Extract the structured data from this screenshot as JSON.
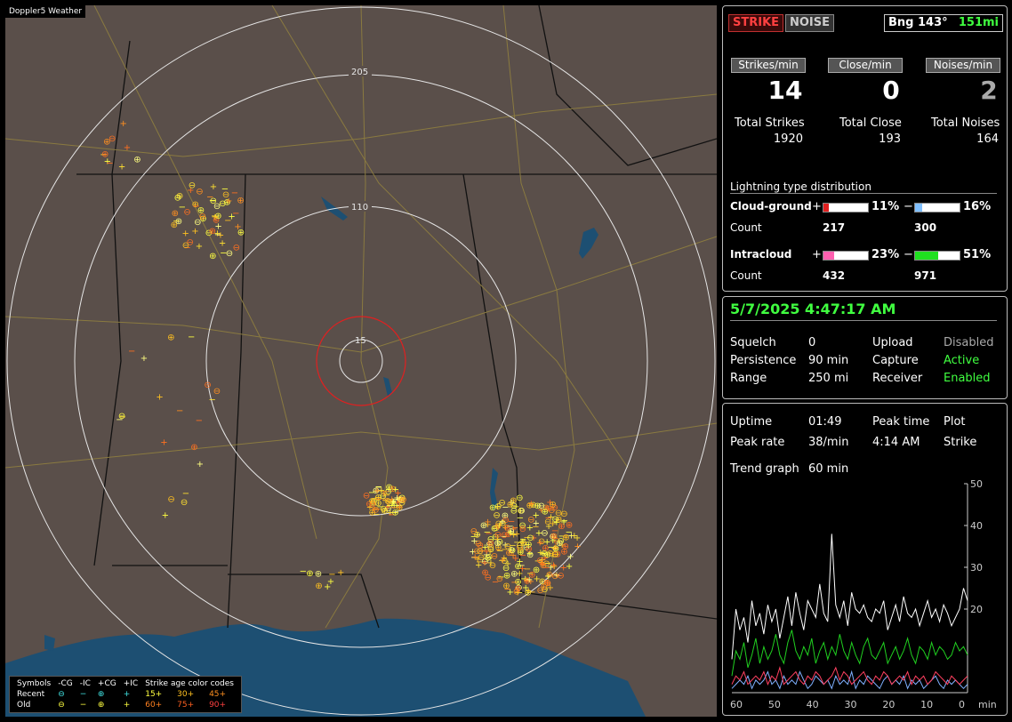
{
  "map": {
    "title": "Doppler5 Weather",
    "ring_labels": [
      "205",
      "110",
      "15"
    ],
    "colors": {
      "land": "#5a4f4a",
      "water": "#1d4f72",
      "ring": "#e6e6e6",
      "close_ring": "#e02020",
      "road": "#8a7a40"
    },
    "legend": {
      "symbols_label": "Symbols",
      "cols": [
        "-CG",
        "-IC",
        "+CG",
        "+IC"
      ],
      "recent_label": "Recent",
      "old_label": "Old",
      "recent_symbols": [
        "⊖",
        "−",
        "⊕",
        "+"
      ],
      "old_symbols": [
        "⊖",
        "−",
        "⊕",
        "+"
      ],
      "age_label": "Strike age color codes",
      "age_row1": [
        "15+",
        "30+",
        "45+"
      ],
      "age_row2": [
        "60+",
        "75+",
        "90+"
      ]
    }
  },
  "status": {
    "strike_btn": "STRIKE",
    "noise_btn": "NOISE",
    "bearing": "Bng 143°",
    "distance": "151mi",
    "headers": [
      "Strikes/min",
      "Close/min",
      "Noises/min"
    ],
    "rates": [
      "14",
      "0",
      "2"
    ],
    "totals_labels": [
      "Total Strikes",
      "Total Close",
      "Total Noises"
    ],
    "totals": [
      "1920",
      "193",
      "164"
    ],
    "dist_title": "Lightning type distribution",
    "cg_label": "Cloud-ground",
    "ic_label": "Intracloud",
    "count_label": "Count",
    "plus": "+",
    "minus": "−",
    "cg_pos_pct": "11%",
    "cg_neg_pct": "16%",
    "ic_pos_pct": "23%",
    "ic_neg_pct": "51%",
    "cg_pos_count": "217",
    "cg_neg_count": "300",
    "ic_pos_count": "432",
    "ic_neg_count": "971",
    "cg_pos_frac": 0.11,
    "cg_neg_frac": 0.16,
    "ic_pos_frac": 0.23,
    "ic_neg_frac": 0.51
  },
  "settings": {
    "datetime": "5/7/2025 4:47:17 AM",
    "rows": [
      {
        "label": "Squelch",
        "value": "0",
        "label2": "Upload",
        "value2": "Disabled"
      },
      {
        "label": "Persistence",
        "value": "90 min",
        "label2": "Capture",
        "value2": "Active"
      },
      {
        "label": "Range",
        "value": "250 mi",
        "label2": "Receiver",
        "value2": "Enabled"
      }
    ]
  },
  "stats": {
    "uptime_label": "Uptime",
    "uptime": "01:49",
    "peak_time_label": "Peak time",
    "plot_label": "Plot",
    "peak_rate_label": "Peak rate",
    "peak_rate": "38/min",
    "peak_time": "4:14 AM",
    "plot_value": "Strike",
    "trend_label": "Trend graph",
    "trend_value": "60 min"
  },
  "chart_data": {
    "type": "line",
    "x_ticks": [
      "60",
      "50",
      "40",
      "30",
      "20",
      "10",
      "0"
    ],
    "x_unit": "min",
    "y_ticks": [
      "50",
      "40",
      "30",
      "20"
    ],
    "ylim": [
      0,
      50
    ],
    "xlim": [
      60,
      0
    ],
    "series": [
      {
        "color": "#ffffff",
        "values": [
          8,
          20,
          15,
          18,
          12,
          22,
          16,
          19,
          14,
          21,
          17,
          20,
          13,
          18,
          23,
          16,
          24,
          19,
          15,
          22,
          20,
          18,
          26,
          19,
          17,
          38,
          21,
          18,
          22,
          16,
          24,
          20,
          19,
          21,
          18,
          17,
          20,
          19,
          22,
          15,
          18,
          21,
          17,
          23,
          19,
          18,
          20,
          16,
          19,
          22,
          18,
          20,
          17,
          21,
          19,
          16,
          18,
          20,
          25,
          22
        ]
      },
      {
        "color": "#20d020",
        "values": [
          4,
          10,
          8,
          12,
          6,
          9,
          13,
          7,
          11,
          8,
          10,
          14,
          9,
          7,
          12,
          15,
          10,
          8,
          11,
          9,
          13,
          7,
          10,
          12,
          8,
          11,
          9,
          14,
          10,
          8,
          12,
          9,
          7,
          11,
          13,
          9,
          8,
          10,
          12,
          7,
          9,
          11,
          8,
          10,
          13,
          9,
          7,
          11,
          10,
          8,
          12,
          9,
          11,
          10,
          8,
          9,
          12,
          10,
          11,
          9
        ]
      },
      {
        "color": "#ff4060",
        "values": [
          2,
          4,
          3,
          5,
          2,
          3,
          4,
          3,
          5,
          2,
          4,
          3,
          6,
          2,
          3,
          4,
          5,
          3,
          2,
          4,
          3,
          5,
          4,
          2,
          3,
          4,
          6,
          3,
          5,
          4,
          2,
          3,
          4,
          5,
          3,
          2,
          4,
          3,
          5,
          4,
          2,
          3,
          4,
          3,
          5,
          2,
          4,
          3,
          4,
          2,
          3,
          5,
          4,
          3,
          2,
          4,
          3,
          2,
          3,
          4
        ]
      },
      {
        "color": "#7fb0ff",
        "values": [
          1,
          2,
          3,
          2,
          4,
          1,
          3,
          2,
          3,
          5,
          2,
          3,
          1,
          4,
          2,
          3,
          2,
          5,
          3,
          1,
          2,
          4,
          3,
          2,
          3,
          1,
          4,
          2,
          3,
          2,
          5,
          1,
          3,
          2,
          4,
          3,
          2,
          1,
          3,
          4,
          2,
          3,
          2,
          4,
          1,
          3,
          2,
          3,
          1,
          2,
          3,
          4,
          2,
          1,
          3,
          2,
          3,
          2,
          1,
          2
        ]
      }
    ]
  }
}
